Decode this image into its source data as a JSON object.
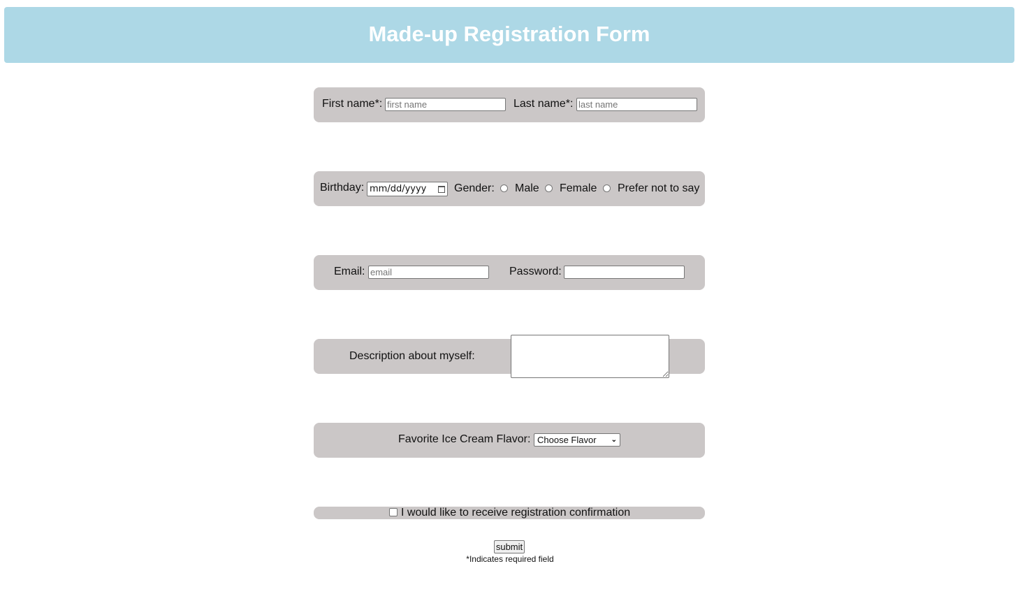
{
  "header": {
    "title": "Made-up Registration Form"
  },
  "name_row": {
    "first_label": "First name*:",
    "first_placeholder": "first name",
    "first_value": "",
    "last_label": "Last name*:",
    "last_placeholder": "last name",
    "last_value": ""
  },
  "birth_row": {
    "birthday_label": "Birthday:",
    "birthday_placeholder": "mm/dd/yyyy",
    "gender_label": "Gender:",
    "gender_options": [
      "Male",
      "Female",
      "Prefer not to say"
    ]
  },
  "account_row": {
    "email_label": "Email:",
    "email_placeholder": "email",
    "password_label": "Password:"
  },
  "description_row": {
    "label": "Description about myself:"
  },
  "flavor_row": {
    "label": "Favorite Ice Cream Flavor:",
    "selected": "Choose Flavor"
  },
  "confirm_row": {
    "label": "I would like to receive registration confirmation",
    "checked": false
  },
  "submit_label": "submit",
  "required_note": "*Indicates required field"
}
